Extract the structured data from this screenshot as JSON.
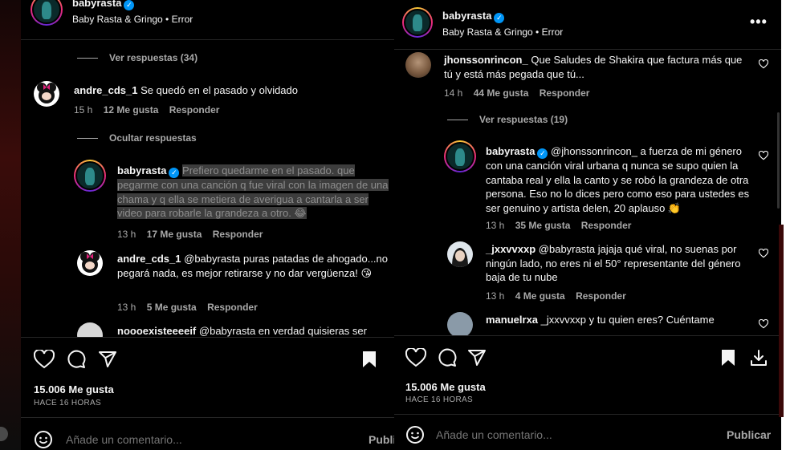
{
  "left": {
    "post_author": "babyrasta",
    "post_subline": "Baby Rasta & Gringo • Error",
    "view_replies_1": "Ver respuestas (34)",
    "comment1": {
      "user": "andre_cds_1",
      "text": "Se quedó en el pasado y olvidado",
      "time": "15 h",
      "likes": "12 Me gusta",
      "reply": "Responder"
    },
    "hide_replies": "Ocultar respuestas",
    "reply1": {
      "user": "babyrasta",
      "text": "Prefiero quedarme en el pasado. que pegarme con una canción q fue viral con la imagen de una chama y q ella se metiera de averigua a cantarla a ser video para robarle la grandeza a otro. 😂",
      "time": "13 h",
      "likes": "17 Me gusta",
      "reply": "Responder"
    },
    "reply2": {
      "user": "andre_cds_1",
      "text": "@babyrasta puras patadas de ahogado...no pegará nada, es mejor retirarse y no dar vergüenza! 😘",
      "time": "13 h",
      "likes": "5 Me gusta",
      "reply": "Responder"
    },
    "reply3": {
      "user": "noooexisteeeeif",
      "text": "@babyrasta en verdad quisieras ser"
    },
    "likes_count": "15.006 Me gusta",
    "time_ago": "HACE 16 HORAS",
    "comment_placeholder": "Añade un comentario...",
    "publish": "Publi"
  },
  "right": {
    "post_author": "babyrasta",
    "post_subline": "Baby Rasta & Gringo • Error",
    "more": "•••",
    "comment1": {
      "user": "jhonssonrincon_",
      "text": "Que Saludes de Shakira que factura más que tú y está más pegada que tú...",
      "time": "14 h",
      "likes": "44 Me gusta",
      "reply": "Responder"
    },
    "view_replies": "Ver respuestas (19)",
    "reply1": {
      "user": "babyrasta",
      "text": "@jhonssonrincon_ a fuerza de mi género con una canción viral urbana q nunca se supo quien la cantaba real y ella la canto y se robó la grandeza de otra persona. Eso no lo dices pero como eso para ustedes es ser genuino y artista delen, 20 aplauso 👏",
      "time": "13 h",
      "likes": "35 Me gusta",
      "reply": "Responder"
    },
    "reply2": {
      "user": "_jxxvvxxp",
      "text": "@babyrasta jajaja qué viral, no suenas por ningún lado, no eres ni el 50° representante del género baja de tu nube",
      "time": "13 h",
      "likes": "4 Me gusta",
      "reply": "Responder"
    },
    "reply3": {
      "user": "manuelrxa",
      "text": "_jxxvvxxp y tu quien eres? Cuéntame"
    },
    "likes_count": "15.006 Me gusta",
    "time_ago": "HACE 16 HORAS",
    "comment_placeholder": "Añade un comentario...",
    "publish": "Publicar"
  },
  "colors": {
    "background": "#000000",
    "text": "#f5f5f5",
    "muted": "#a8a8a8",
    "verified": "#0095f6"
  }
}
